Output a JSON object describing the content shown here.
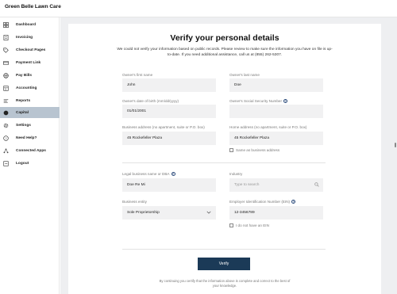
{
  "app": {
    "brand": "Green Belle Lawn Care"
  },
  "sidebar": {
    "items": [
      {
        "label": "Dashboard",
        "icon": "grid-icon",
        "active": false
      },
      {
        "label": "Invoicing",
        "icon": "invoice-icon",
        "active": false
      },
      {
        "label": "Checkout Pages",
        "icon": "tag-icon",
        "active": false
      },
      {
        "label": "Payment Link",
        "icon": "link-card-icon",
        "active": false
      },
      {
        "label": "Pay Bills",
        "icon": "globe-icon",
        "active": false
      },
      {
        "label": "Accounting",
        "icon": "ledger-icon",
        "active": false
      },
      {
        "label": "Reports",
        "icon": "reports-icon",
        "active": false
      },
      {
        "label": "Capital",
        "icon": "capital-icon",
        "active": true
      },
      {
        "label": "Settings",
        "icon": "gear-icon",
        "active": false
      },
      {
        "label": "Need Help?",
        "icon": "help-icon",
        "active": false
      },
      {
        "label": "Connected Apps",
        "icon": "apps-icon",
        "active": false
      },
      {
        "label": "Logout",
        "icon": "logout-icon",
        "active": false
      }
    ]
  },
  "page": {
    "title": "Verify your personal details",
    "subtitle": "We could not verify your information based on public records. Please review to make sure the information you have on file is up-to-date. If you need additional assistance, call us at (855) 262-5307."
  },
  "form": {
    "first_name": {
      "label": "Owner's first name",
      "value": "John"
    },
    "last_name": {
      "label": "Owner's last name",
      "value": "Doe"
    },
    "dob": {
      "label": "Owner's date of birth (mm/dd/yyyy)",
      "value": "01/01/2001"
    },
    "ssn": {
      "label": "Owner's Social Security Number",
      "value": ""
    },
    "business_address": {
      "label": "Business address (no apartment, suite or P.O. box)",
      "value": "45 Rockefeller Plaza"
    },
    "home_address": {
      "label": "Home address (no apartment, suite or P.O. box)",
      "value": "45 Rockefeller Plaza"
    },
    "same_as_business": {
      "label": "Same as business address",
      "checked": false
    },
    "legal_name": {
      "label": "Legal business name or DBA",
      "value": "Doe Re Mi"
    },
    "industry": {
      "label": "Industry",
      "placeholder": "Type to search"
    },
    "business_entity": {
      "label": "Business entity",
      "value": "Sole Proprietorship"
    },
    "ein": {
      "label": "Employer Identification Number (EIN)",
      "value": "12-3456789"
    },
    "no_ein": {
      "label": "I do not have an EIN",
      "checked": false
    }
  },
  "actions": {
    "verify_label": "Verify",
    "footnote": "By continuing you certify that the information above is complete and correct to the best of your knowledge."
  },
  "colors": {
    "primary": "#1b3a57",
    "active_nav": "#b8c4d0",
    "help": "#2a4a7a"
  }
}
